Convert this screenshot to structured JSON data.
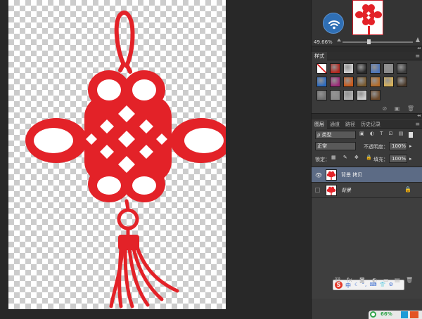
{
  "navigator": {
    "zoom": "49.66%"
  },
  "styles_panel": {
    "tab_label": "样式",
    "swatches": [
      "#ffffff",
      "#b3261e",
      "#cfcfcf",
      "#2a2a2a",
      "#4d74b8",
      "#8a8a8a",
      "#3d3d3d",
      "#2c6bbf",
      "#9e2b7a",
      "#c95a1a",
      "#7a5a2e",
      "#b56d2a",
      "#d8b25a",
      "#4b3a2a",
      "#6f6f6f",
      "#8a8a8a",
      "#b0b0b0",
      "#cfcfcf",
      "#6d4a2a"
    ]
  },
  "layers_panel": {
    "tabs": [
      "图层",
      "通道",
      "路径",
      "历史记录"
    ],
    "filter_label": "ρ 类型",
    "blend_mode": "正常",
    "opacity_label": "不透明度：",
    "opacity_value": "100%",
    "lock_label": "锁定：",
    "fill_label": "填充：",
    "fill_value": "100%",
    "layers": [
      {
        "name": "背景 拷贝",
        "visible": true,
        "selected": true,
        "locked": false
      },
      {
        "name": "背景",
        "visible": false,
        "selected": false,
        "locked": true
      }
    ]
  },
  "ime": {
    "logo": "S",
    "mode": "中"
  },
  "tray": {
    "percent": "66%"
  },
  "colors": {
    "knot_red": "#e32228",
    "panel_bg": "#3a3a3a",
    "workspace_bg": "#282828",
    "selection_blue": "#5c6b85"
  }
}
